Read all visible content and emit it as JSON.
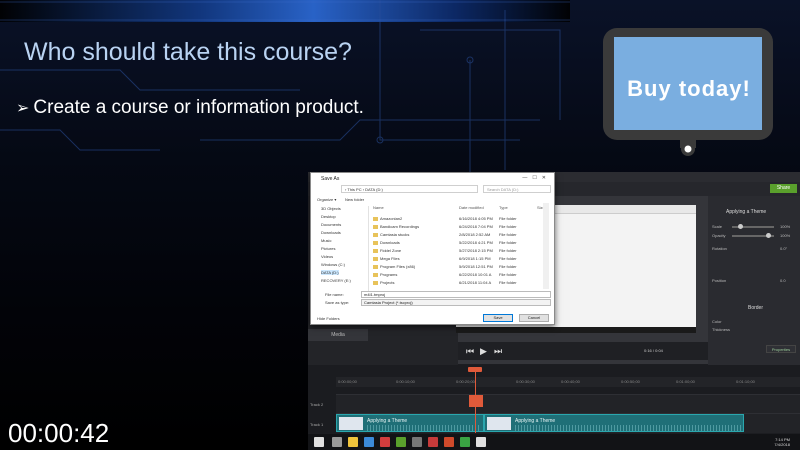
{
  "slide": {
    "title": "Who should take this course?",
    "bullet_arrow": "➢",
    "bullet": "Create a course or information product.",
    "badge_text": "Buy today!",
    "timer": "00:00:42",
    "colors": {
      "title": "#b9d3f2",
      "badge_screen": "#7aaee0",
      "badge_frame": "#3a3a3a"
    }
  },
  "save_dialog": {
    "title": "Save As",
    "address": "› This PC › DATA (D:)",
    "search_placeholder": "Search DATA (D:)",
    "commands": [
      "Organize ▾",
      "New folder"
    ],
    "nav_items": [
      "3D Objects",
      "Desktop",
      "Documents",
      "Downloads",
      "Music",
      "Pictures",
      "Videos",
      "Windows (C:)",
      "DATA (D:)",
      "RECOVERY (E:)"
    ],
    "columns": [
      "Name",
      "Date modified",
      "Type",
      "Size"
    ],
    "files": [
      {
        "name": "Amazonian2",
        "date": "6/16/2018 4:05 PM",
        "type": "File folder"
      },
      {
        "name": "Bandicam Recordings",
        "date": "6/24/2018 7:04 PM",
        "type": "File folder"
      },
      {
        "name": "Camtasia stucks",
        "date": "2/8/2018 2:52 AM",
        "type": "File folder"
      },
      {
        "name": "Downloads",
        "date": "5/22/2018 4:21 PM",
        "type": "File folder"
      },
      {
        "name": "Fiddel Zone",
        "date": "5/27/2018 2:15 PM",
        "type": "File folder"
      },
      {
        "name": "Mega Files",
        "date": "6/9/2018 1:15 PM",
        "type": "File folder"
      },
      {
        "name": "Program Files (x86)",
        "date": "5/9/2018 12:51 PM",
        "type": "File folder"
      },
      {
        "name": "Programs",
        "date": "6/22/2018 10:01 A",
        "type": "File folder"
      },
      {
        "name": "Projects",
        "date": "6/21/2018 11:04 A",
        "type": "File folder"
      }
    ],
    "file_name_label": "File name:",
    "file_name_value": "m4I1.tmproj",
    "save_type_label": "Save as type:",
    "save_type_value": "Camtasia Project (*.tscproj)",
    "hide_folders": "Hide Folders",
    "save_button": "Save",
    "cancel_button": "Cancel"
  },
  "camtasia": {
    "export_label": "Share",
    "properties_title": "Applying a Theme",
    "properties": [
      {
        "label": "Scale",
        "value": "100%"
      },
      {
        "label": "Opacity",
        "value": "100%"
      },
      {
        "label": "Rotation",
        "value": "0.0°"
      },
      {
        "label": "Position",
        "value": "0.0"
      }
    ],
    "behavior_title": "Border",
    "color_label": "Color",
    "thickness_label": "Thickness",
    "properties_button": "Properties",
    "media_tab": "Media",
    "timecode": "0:16 / 0:04",
    "ruler_marks": [
      "0:00:00;00",
      "0:00:10;00",
      "0:00:20;00",
      "0:00:30;00",
      "0:00:40;00",
      "0:00:50;00",
      "0:01:00;00",
      "0:01:10;00",
      "0:01:20;00",
      "0:01:30;00",
      "0:01:40;00"
    ],
    "tracks": [
      "Track 2",
      "Track 1"
    ],
    "clips": [
      {
        "label": "Applying a Theme"
      },
      {
        "label": "Applying a Theme"
      }
    ],
    "clip_color": "#1f6f77",
    "playhead_color": "#e05a3a"
  },
  "taskbar": {
    "time": "7:14 PM",
    "date": "7/4/2018",
    "icon_colors": [
      "#e0e0e0",
      "#9a9a9a",
      "#f0c43c",
      "#3c8ad8",
      "#d23d3d",
      "#5aa02c",
      "#777",
      "#c63a3a",
      "#cf4a2b",
      "#3aa343"
    ]
  }
}
